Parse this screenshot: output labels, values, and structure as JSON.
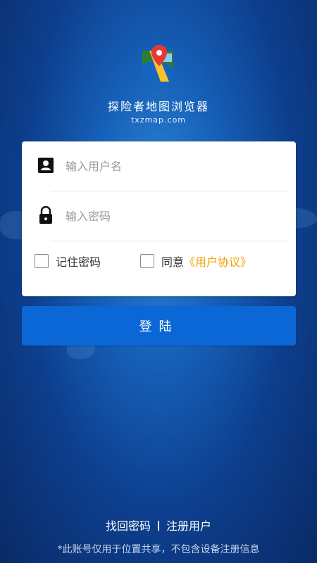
{
  "app": {
    "title": "探险者地图浏览器",
    "domain": "txzmap.com"
  },
  "login_form": {
    "username_placeholder": "输入用户名",
    "password_placeholder": "输入密码",
    "remember_label": "记住密码",
    "agree_label": "同意",
    "agreement_link": "《用户协议》"
  },
  "login_button": {
    "label": "登陆"
  },
  "footer": {
    "forgot_password": "找回密码",
    "register": "注册用户",
    "disclaimer": "*此账号仅用于位置共享，不包含设备注册信息"
  },
  "colors": {
    "primary_button": "#0b67d6",
    "link_accent": "#f4a10b",
    "background": "#0d3f8e"
  },
  "icons": {
    "logo": "map-pin-logo-icon",
    "username": "user-card-icon",
    "password": "lock-icon"
  }
}
